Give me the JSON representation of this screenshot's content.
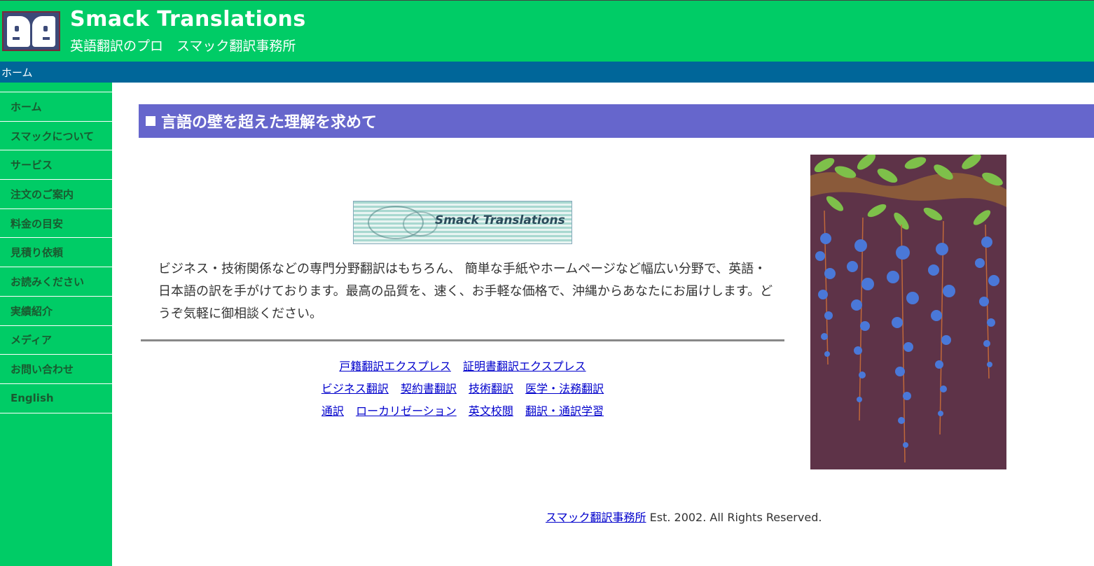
{
  "header": {
    "title": "Smack Translations",
    "subtitle": "英語翻訳のプロ　スマック翻訳事務所"
  },
  "breadcrumb": "ホーム",
  "sidebar": {
    "items": [
      {
        "label": "ホーム"
      },
      {
        "label": "スマックについて"
      },
      {
        "label": "サービス"
      },
      {
        "label": "注文のご案内"
      },
      {
        "label": "料金の目安"
      },
      {
        "label": "見積り依頼"
      },
      {
        "label": "お読みください"
      },
      {
        "label": "実績紹介"
      },
      {
        "label": "メディア"
      },
      {
        "label": "お問い合わせ"
      },
      {
        "label": "English"
      }
    ]
  },
  "main": {
    "heading": "言語の壁を超えた理解を求めて",
    "banner_text": "Smack Translations",
    "intro": "ビジネス・技術関係などの専門分野翻訳はもちろん、 簡単な手紙やホームページなど幅広い分野で、英語・日本語の訳を手がけております。最高の品質を、速く、お手軽な価格で、沖縄からあなたにお届けします。どうぞ気軽に御相談ください。",
    "link_rows": [
      [
        "戸籍翻訳エクスプレス",
        "証明書翻訳エクスプレス"
      ],
      [
        "ビジネス翻訳",
        "契約書翻訳",
        "技術翻訳",
        "医学・法務翻訳"
      ],
      [
        "通訳",
        "ローカリゼーション",
        "英文校閲",
        "翻訳・通訳学習"
      ]
    ]
  },
  "footer": {
    "link": "スマック翻訳事務所",
    "text": " Est. 2002. All Rights Reserved."
  },
  "colors": {
    "brand_green": "#00cc66",
    "nav_blue": "#006699",
    "heading_purple": "#6666cc",
    "link_blue": "#0000cc"
  }
}
